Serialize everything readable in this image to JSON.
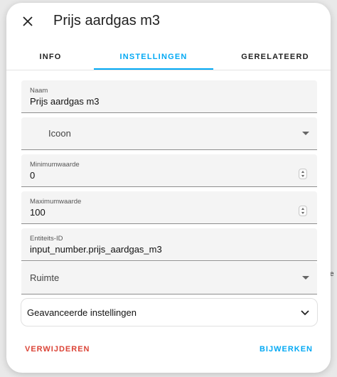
{
  "dialog": {
    "title": "Prijs aardgas m3",
    "close_icon": "close-icon"
  },
  "tabs": [
    {
      "label": "INFO",
      "active": false
    },
    {
      "label": "INSTELLINGEN",
      "active": true
    },
    {
      "label": "GERELATEERD",
      "active": false
    }
  ],
  "fields": {
    "name": {
      "label": "Naam",
      "value": "Prijs aardgas m3"
    },
    "icon": {
      "placeholder": "Icoon"
    },
    "min": {
      "label": "Minimumwaarde",
      "value": "0"
    },
    "max": {
      "label": "Maximumwaarde",
      "value": "100"
    },
    "entity_id": {
      "label": "Entiteits-ID",
      "value": "input_number.prijs_aardgas_m3"
    },
    "area": {
      "placeholder": "Ruimte"
    }
  },
  "advanced": {
    "label": "Geavanceerde instellingen"
  },
  "footer": {
    "delete_label": "VERWIJDEREN",
    "update_label": "BIJWERKEN"
  },
  "colors": {
    "accent": "#03a9f4",
    "danger": "#db4437"
  },
  "backdrop": {
    "edge_text": "e"
  }
}
